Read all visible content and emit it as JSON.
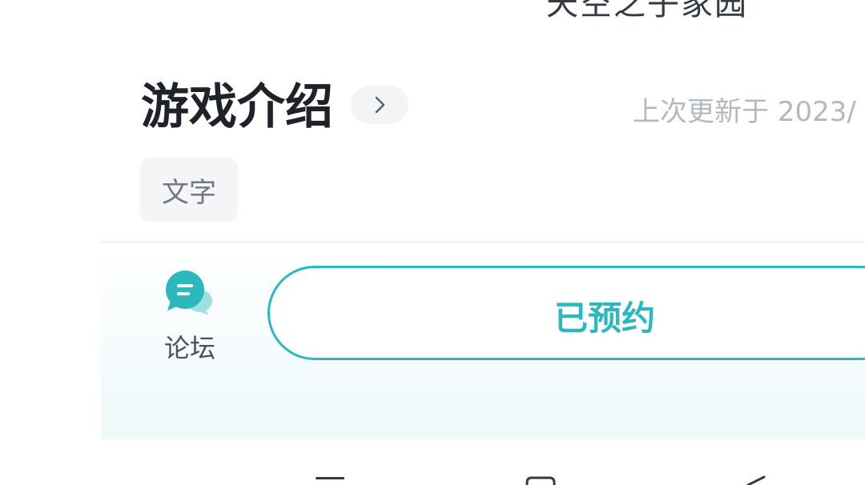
{
  "header": {
    "cut_title": "天空之子家园"
  },
  "intro_section": {
    "title": "游戏介绍",
    "update_text": "上次更新于 2023/",
    "tags": [
      "文字"
    ]
  },
  "bottom_bar": {
    "forum_label": "论坛",
    "reserve_label": "已预约",
    "accent_color": "#2cb8bd"
  },
  "system_nav": {
    "icons": [
      "menu-icon",
      "home-icon",
      "back-icon"
    ]
  }
}
